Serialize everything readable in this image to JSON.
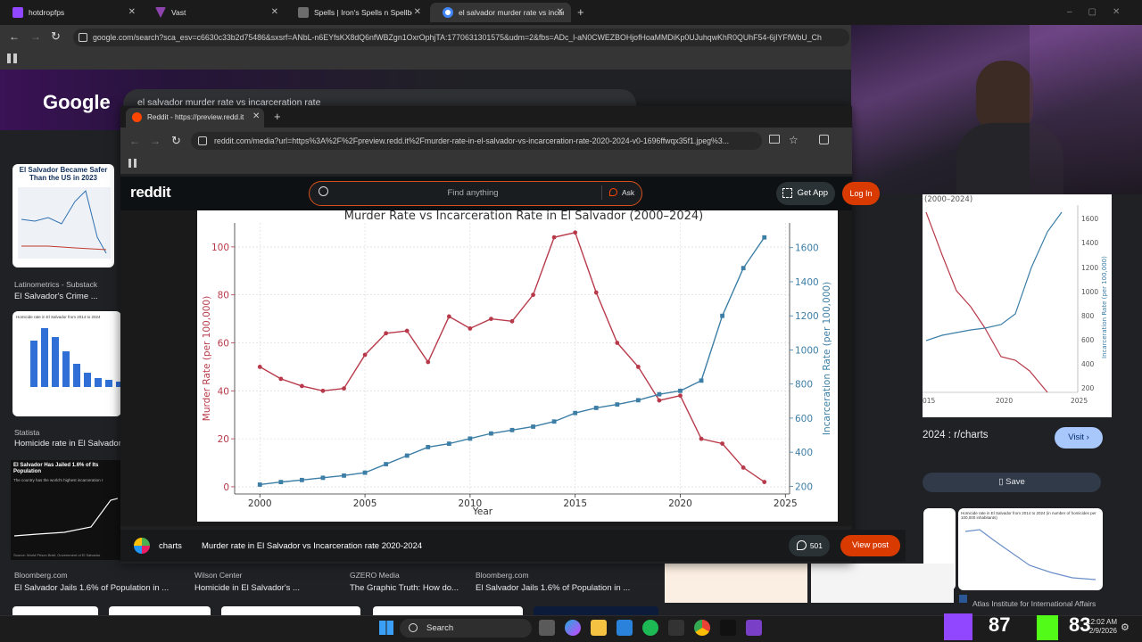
{
  "outer_browser": {
    "tabs": [
      {
        "label": "hotdropfps",
        "color": "#9146ff"
      },
      {
        "label": "Vast",
        "color": "#8e44ad"
      },
      {
        "label": "Spells | Iron's Spells n Spellbook",
        "color": "#888888"
      },
      {
        "label": "el salvador murder rate vs incar",
        "color": "#4285f4"
      }
    ],
    "url": "google.com/search?sca_esv=c6630c33b2d75486&sxsrf=ANbL-n6EYfsKX8dQ6nfWBZgn1OxrOphjTA:1770631301575&udm=2&fbs=ADc_l-aN0CWEZBOHjofHoaMMDiKp0UJuhqwKhR0QUhF54-6jIYFfWbU_Ch"
  },
  "google": {
    "logo": "Google",
    "query": "el salvador murder rate vs incarceration rate",
    "results_left": [
      {
        "thumb_title": "El Salvador Became Safer Than the US in 2023",
        "source": "Latinometrics - Substack",
        "title": "El Salvador's Crime ..."
      },
      {
        "thumb_title": "Homicide rate in El Salvador from 2014 to 2024",
        "source": "Statista",
        "title": "Homicide rate in El Salvador"
      },
      {
        "thumb_title": "El Salvador Has Jailed 1.6% of Its Population",
        "thumb_sub": "The country has the world's highest incarceration r",
        "thumb_foot": "Source: World Prison Brief, Government of El Salvador",
        "source": "Bloomberg.com",
        "title": "El Salvador Jails 1.6% of Population in ..."
      }
    ],
    "results_bottom": [
      {
        "source": "Wilson Center",
        "title": "Homicide in El Salvador's ..."
      },
      {
        "source": "GZERO Media",
        "title": "The Graphic Truth: How do..."
      },
      {
        "source": "Bloomberg.com",
        "title": "El Salvador Jails 1.6% of Population in ..."
      }
    ],
    "right_panel": {
      "chart_title_fragment": "(2000–2024)",
      "x_ticks": [
        "015",
        "2020",
        "2025"
      ],
      "y_ticks": [
        "1600",
        "1400",
        "1200",
        "1000",
        "800",
        "600",
        "400",
        "200"
      ],
      "y_label": "Incarceration Rate (per 100,000)",
      "post_title": "2024 : r/charts",
      "visit_label": "Visit",
      "save_label": "Save",
      "related_thumb": "Homicide rate in El Salvador from 2014 to 2024 (in number of homicides per 100,000 inhabitants)",
      "related_source": "Atlas Institute for International Affairs"
    }
  },
  "popup": {
    "tab_label": "Reddit - https://preview.redd.it",
    "url": "reddit.com/media?url=https%3A%2F%2Fpreview.redd.it%2Fmurder-rate-in-el-salvador-vs-incarceration-rate-2020-2024-v0-1696ffwqx35f1.jpeg%3...",
    "reddit": {
      "logo": "reddit",
      "search_placeholder": "Find anything",
      "ask_label": "Ask",
      "get_app_label": "Get App",
      "login_label": "Log In"
    },
    "post": {
      "subreddit": "charts",
      "title": "Murder rate in El Salvador vs Incarceration rate 2020-2024",
      "comments": "501",
      "view_post_label": "View post"
    }
  },
  "taskbar": {
    "search_label": "Search",
    "overlay_left": "87",
    "overlay_right": "83",
    "time": "12:02 AM",
    "date": "2/9/2026"
  },
  "chart_data": {
    "type": "line",
    "title": "Murder Rate vs Incarceration Rate in El Salvador (2000–2024)",
    "xlabel": "Year",
    "ylabel_left": "Murder Rate (per 100,000)",
    "ylabel_right": "Incarceration Rate (per 100,000)",
    "x_ticks": [
      2000,
      2005,
      2010,
      2015,
      2020,
      2025
    ],
    "y_left_ticks": [
      0,
      20,
      40,
      60,
      80,
      100
    ],
    "y_right_ticks": [
      200,
      400,
      600,
      800,
      1000,
      1200,
      1400,
      1600
    ],
    "xlim": [
      1998.8,
      2025.2
    ],
    "ylim_left": [
      -3,
      110
    ],
    "ylim_right": [
      155,
      1745
    ],
    "grid": true,
    "x": [
      2000,
      2001,
      2002,
      2003,
      2004,
      2005,
      2006,
      2007,
      2008,
      2009,
      2010,
      2011,
      2012,
      2013,
      2014,
      2015,
      2016,
      2017,
      2018,
      2019,
      2020,
      2021,
      2022,
      2023,
      2024
    ],
    "series": [
      {
        "name": "Murder Rate",
        "axis": "left",
        "color": "#b83a4a",
        "values": [
          50,
          45,
          42,
          40,
          41,
          55,
          64,
          65,
          52,
          71,
          66,
          70,
          69,
          80,
          104,
          106,
          81,
          60,
          50,
          36,
          38,
          20,
          18,
          8,
          2
        ]
      },
      {
        "name": "Incarceration Rate",
        "axis": "right",
        "color": "#3c7ea6",
        "values": [
          210,
          225,
          237,
          250,
          263,
          280,
          330,
          380,
          430,
          450,
          480,
          510,
          530,
          550,
          580,
          630,
          660,
          680,
          705,
          740,
          760,
          820,
          1200,
          1480,
          1660
        ]
      }
    ]
  }
}
